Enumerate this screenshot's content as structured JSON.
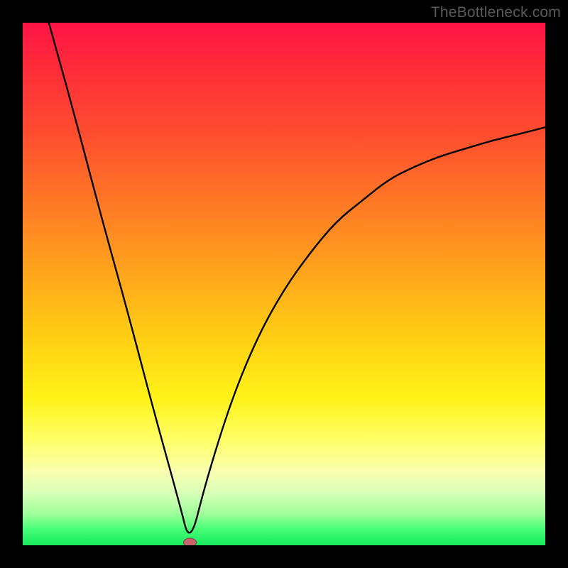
{
  "watermark": "TheBottleneck.com",
  "colors": {
    "frame": "#000000",
    "curve": "#000000",
    "min_marker_fill": "#c6646b",
    "min_marker_stroke": "#8d3d44"
  },
  "chart_data": {
    "type": "line",
    "title": "",
    "xlabel": "",
    "ylabel": "",
    "xlim": [
      0,
      100
    ],
    "ylim": [
      0,
      100
    ],
    "grid": false,
    "legend": false,
    "curve": {
      "minimum_x": 32,
      "minimum_y": 0,
      "left_branch_start": {
        "x": 5,
        "y": 100
      },
      "right_branch_end": {
        "x": 100,
        "y": 80
      },
      "x": [
        5,
        10,
        15,
        20,
        25,
        30,
        32,
        35,
        40,
        45,
        50,
        55,
        60,
        65,
        70,
        75,
        80,
        85,
        90,
        95,
        100
      ],
      "y": [
        100,
        82,
        63,
        45,
        26,
        8,
        0,
        12,
        28,
        40,
        49,
        56,
        62,
        66,
        70,
        72.5,
        74.5,
        76,
        77.5,
        78.7,
        80
      ]
    },
    "gradient_stops": [
      {
        "pos": 0.0,
        "color": "#ff1345"
      },
      {
        "pos": 0.22,
        "color": "#ff4f2f"
      },
      {
        "pos": 0.48,
        "color": "#ffa51c"
      },
      {
        "pos": 0.72,
        "color": "#fff318"
      },
      {
        "pos": 0.86,
        "color": "#f9ffb0"
      },
      {
        "pos": 0.97,
        "color": "#45ff77"
      },
      {
        "pos": 1.0,
        "color": "#16e85e"
      }
    ]
  }
}
